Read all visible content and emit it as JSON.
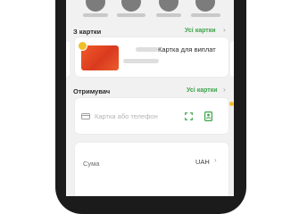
{
  "quick_actions": {
    "items": [
      {
        "icon": "service-icon"
      },
      {
        "icon": "service-icon"
      },
      {
        "icon": "service-icon"
      },
      {
        "icon": "service-icon"
      }
    ]
  },
  "from_section": {
    "title": "З картки",
    "link": "Усі картки",
    "card": {
      "name": "Картка для виплат",
      "masked_number": "* ****",
      "balance_hidden": "00 000 000"
    }
  },
  "recipient_section": {
    "title": "Отримувач",
    "link": "Усі картки",
    "input_placeholder": "Картка або телефон"
  },
  "amount_section": {
    "label": "Сума",
    "currency": "UAH"
  },
  "colors": {
    "accent_green": "#3ea34a",
    "card_red": "#ec4a25",
    "badge_yellow": "#f0c02a",
    "screen_bg": "#f1f1f1"
  }
}
